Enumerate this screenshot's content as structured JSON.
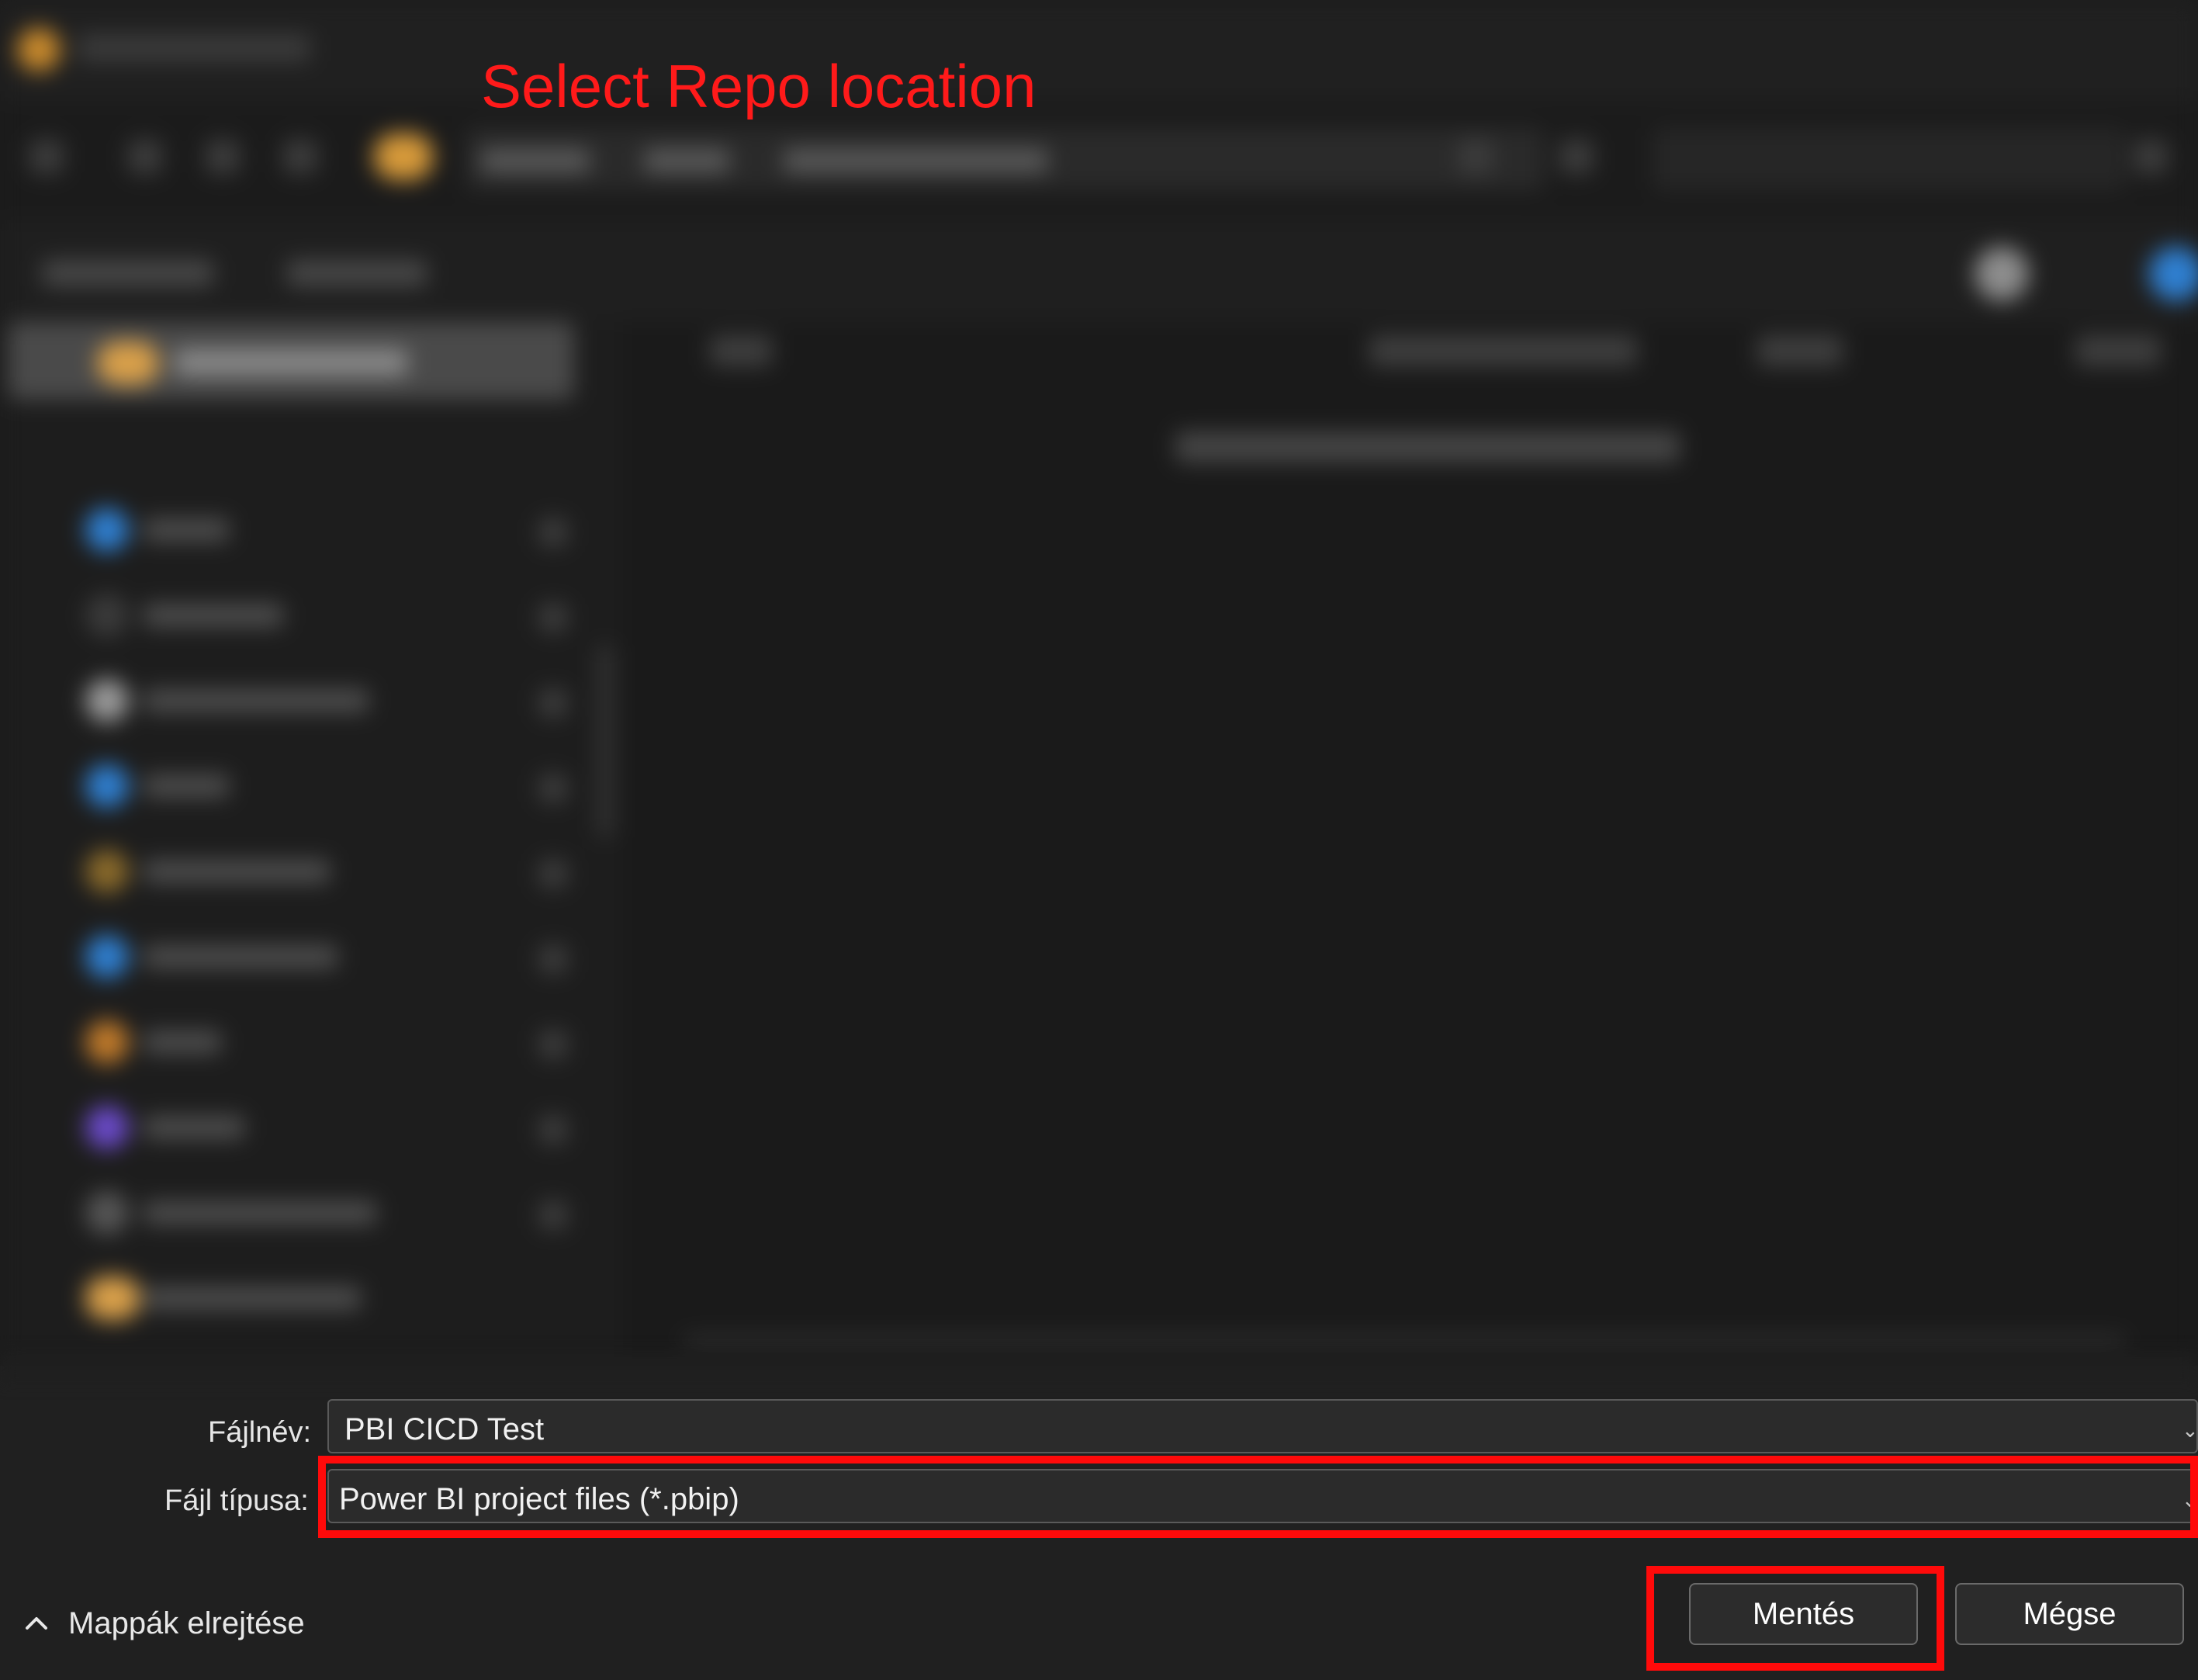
{
  "annotation": {
    "title": "Select Repo location",
    "color": "#ff1a1a"
  },
  "form": {
    "filename_label": "Fájlnév:",
    "filename_value": "PBI CICD Test",
    "filetype_label": "Fájl típusa:",
    "filetype_value": "Power BI project files (*.pbip)"
  },
  "buttons": {
    "save": "Mentés",
    "cancel": "Mégse"
  },
  "footer": {
    "hide_folders": "Mappák elrejtése"
  },
  "colors": {
    "highlight": "#ff0a0a",
    "dialog_bg": "#202020",
    "folder_accent": "#d79a3a"
  },
  "icons": {
    "app": "app-logo-icon",
    "back": "back-arrow-icon",
    "forward": "forward-arrow-icon",
    "up": "up-arrow-icon",
    "refresh": "refresh-icon",
    "folder": "folder-icon",
    "search": "search-icon",
    "collapse": "chevron-up-icon",
    "dropdown": "chevron-down-icon"
  }
}
